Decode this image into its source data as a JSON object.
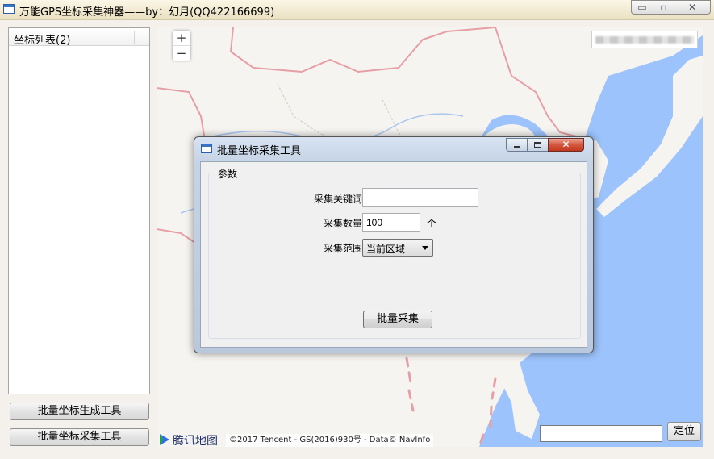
{
  "window": {
    "title": "万能GPS坐标采集神器——by：幻月(QQ422166699)",
    "minimize_glyph": "▭",
    "maximize_glyph": "▫",
    "close_glyph": "✕"
  },
  "left_panel": {
    "list_header": "坐标列表(2)",
    "generate_button": "批量坐标生成工具",
    "collect_button": "批量坐标采集工具"
  },
  "map": {
    "zoom_in": "+",
    "zoom_out": "−",
    "logo_text": "腾讯地图",
    "copyright": "©2017 Tencent - GS(2016)930号 - Data© NavInfo",
    "locate_input_value": "",
    "locate_button": "定位",
    "colors": {
      "sea": "#9cc3fb",
      "land": "#f6f4f1",
      "border": "#e6a0a5",
      "river": "#a9c6ef"
    }
  },
  "dialog": {
    "title": "批量坐标采集工具",
    "close_glyph": "✕",
    "group_label": "参数",
    "keyword_label": "采集关键词",
    "keyword_value": "",
    "count_label": "采集数量",
    "count_value": "100",
    "count_unit": "个",
    "range_label": "采集范围",
    "range_value": "当前区域",
    "submit_button": "批量采集"
  }
}
